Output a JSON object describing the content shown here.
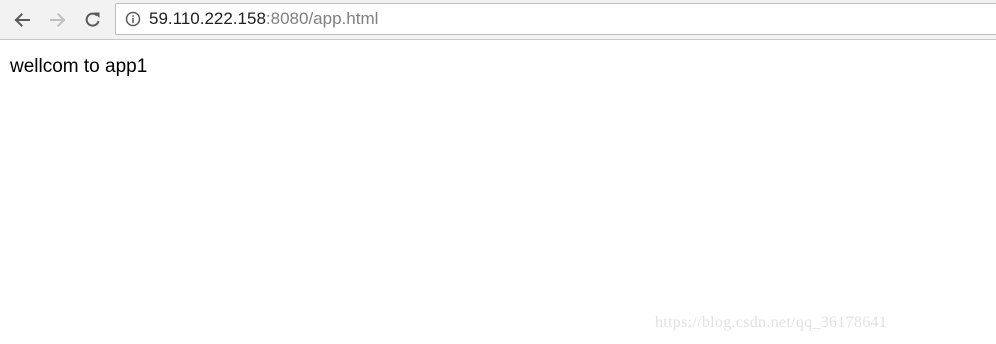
{
  "browser": {
    "url_host": "59.110.222.158",
    "url_rest": ":8080/app.html",
    "icons": {
      "back": "arrow-left-icon",
      "forward": "arrow-right-icon",
      "reload": "reload-icon",
      "security": "info-icon"
    },
    "colors": {
      "toolbar_bg": "#f2f2f2",
      "url_host": "#202020",
      "url_rest": "#808080",
      "forward_disabled": "#c0c0c0"
    }
  },
  "page": {
    "text": "wellcom to app1"
  },
  "watermark": {
    "text": "https://blog.csdn.net/qq_36178641"
  }
}
